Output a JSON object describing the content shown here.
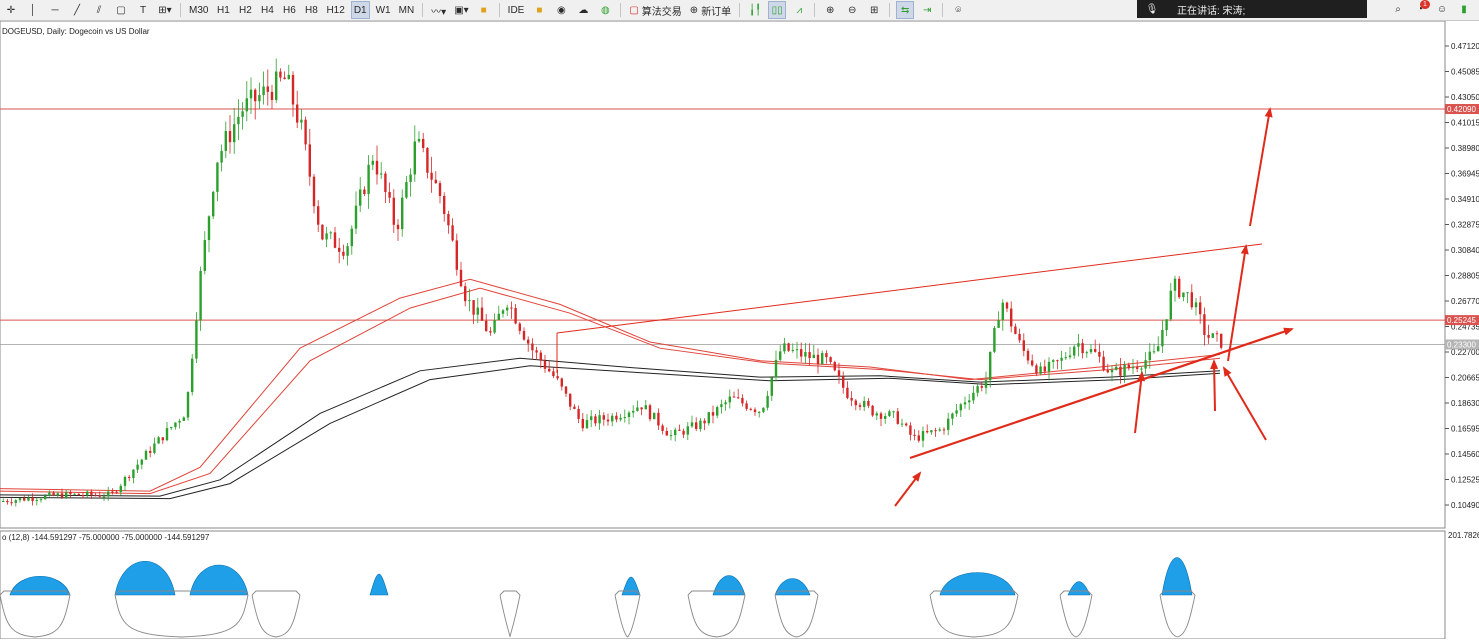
{
  "toolbar": {
    "timeframes": [
      "M30",
      "H1",
      "H2",
      "H4",
      "H6",
      "H8",
      "H12",
      "D1",
      "W1",
      "MN"
    ],
    "active_timeframe": "D1",
    "ide_label": "IDE",
    "algo_trading_label": "算法交易",
    "new_order_label": "新订单",
    "notification_count": "1"
  },
  "speaking_overlay": {
    "text": "正在讲话: 宋涛;"
  },
  "chart": {
    "symbol_title": "DOGEUSD, Daily: Dogecoin vs US Dollar",
    "price_labels": [
      "0.47120",
      "0.45085",
      "0.43050",
      "0.41015",
      "0.38980",
      "0.36945",
      "0.34910",
      "0.32875",
      "0.30840",
      "0.28805",
      "0.26770",
      "0.24735",
      "0.22700",
      "0.20665",
      "0.18630",
      "0.16595",
      "0.14560",
      "0.12525",
      "0.10490"
    ],
    "hline_labels": [
      "0.42090",
      "0.25245"
    ],
    "current_price_label": "0.23300",
    "colors": {
      "bull": "#2ca02c",
      "bear": "#d62728",
      "annotation": "#e02a1a",
      "ma_red": "#e0443a",
      "ma_black": "#222222",
      "hline": "#d9534f",
      "osc_fill": "#1e9fe8"
    }
  },
  "indicator": {
    "label": "o (12,8) -144.591297 -75.000000 -75.000000 -144.591297",
    "scale_max_label": "201.7826"
  }
}
